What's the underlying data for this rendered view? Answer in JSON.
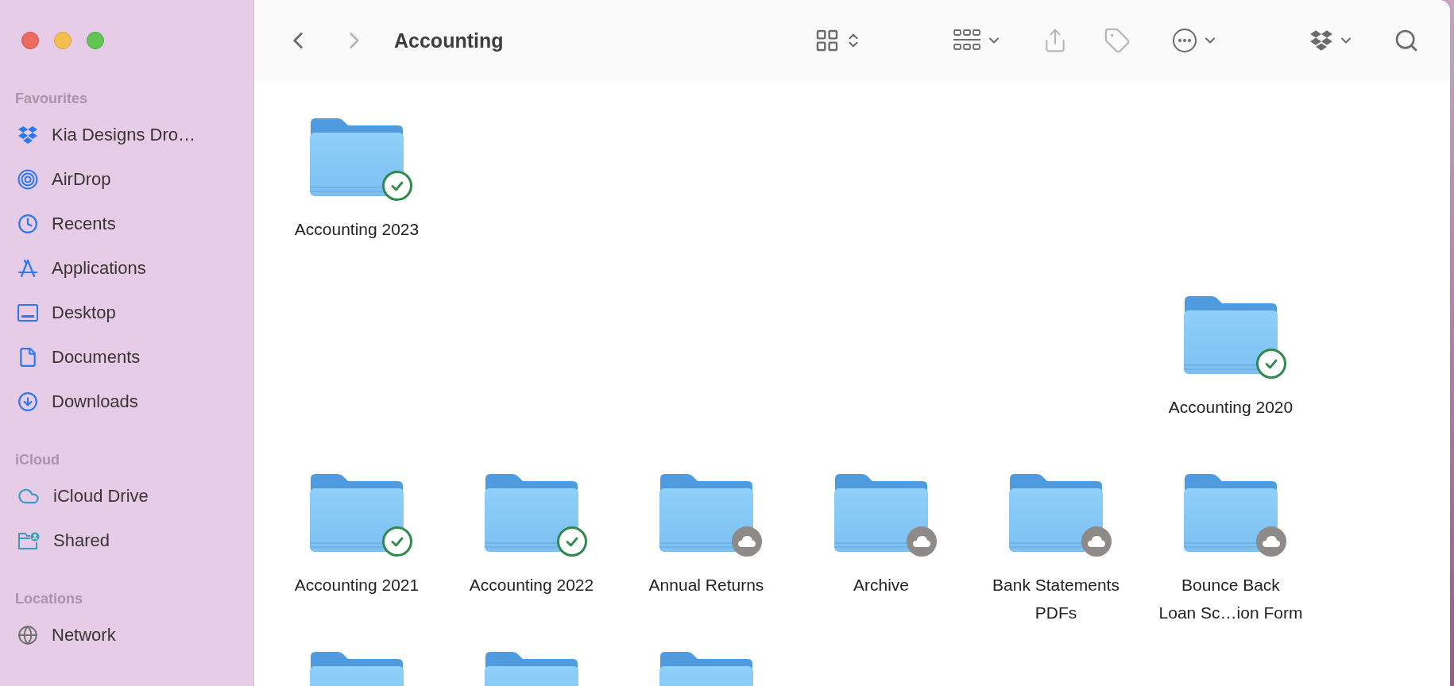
{
  "window": {
    "controls": [
      {
        "kind": "close"
      },
      {
        "kind": "minimize"
      },
      {
        "kind": "zoom"
      }
    ]
  },
  "sidebar": {
    "sections": [
      {
        "heading": "Favourites",
        "items": [
          {
            "kind": "dropbox",
            "label": "Kia Designs Dro…"
          },
          {
            "kind": "airdrop",
            "label": "AirDrop"
          },
          {
            "kind": "recents",
            "label": "Recents"
          },
          {
            "kind": "applications",
            "label": "Applications"
          },
          {
            "kind": "desktop",
            "label": "Desktop"
          },
          {
            "kind": "documents",
            "label": "Documents"
          },
          {
            "kind": "downloads",
            "label": "Downloads"
          }
        ]
      },
      {
        "heading": "iCloud",
        "items": [
          {
            "kind": "icloud",
            "label": "iCloud Drive"
          },
          {
            "kind": "shared",
            "label": "Shared"
          }
        ]
      },
      {
        "heading": "Locations",
        "items": [
          {
            "kind": "network",
            "label": "Network"
          }
        ]
      }
    ]
  },
  "toolbar": {
    "title": "Accounting",
    "buttons": [
      {
        "kind": "back",
        "disabled": false
      },
      {
        "kind": "forward",
        "disabled": true
      },
      {
        "kind": "view",
        "disabled": false
      },
      {
        "kind": "group",
        "disabled": false
      },
      {
        "kind": "share",
        "disabled": true
      },
      {
        "kind": "tag",
        "disabled": true
      },
      {
        "kind": "more",
        "disabled": false
      },
      {
        "kind": "dropbox",
        "disabled": false
      },
      {
        "kind": "search",
        "disabled": false
      }
    ]
  },
  "icon_rows": [
    {
      "right_aligned": false,
      "items": [
        {
          "kind": "folder",
          "label": "Accounting 2023",
          "synced": true
        }
      ]
    },
    {
      "right_aligned": true,
      "items": [
        {
          "kind": "folder",
          "label": "Accounting 2020",
          "synced": true
        }
      ]
    },
    {
      "right_aligned": false,
      "items": [
        {
          "kind": "folder",
          "label": "Accounting 2021",
          "synced": true
        },
        {
          "kind": "folder",
          "label": "Accounting 2022",
          "synced": true
        },
        {
          "kind": "folder",
          "label": "Annual Returns",
          "synced": false
        },
        {
          "kind": "folder",
          "label": "Archive",
          "synced": false
        },
        {
          "kind": "folder",
          "label": "Bank Statements\nPDFs",
          "synced": false
        },
        {
          "kind": "folder",
          "label": "Bounce Back\nLoan Sc…ion Form",
          "synced": false
        }
      ]
    },
    {
      "right_aligned": false,
      "items": [
        {
          "kind": "folder"
        },
        {
          "kind": "folder"
        },
        {
          "kind": "folder"
        }
      ]
    }
  ]
}
